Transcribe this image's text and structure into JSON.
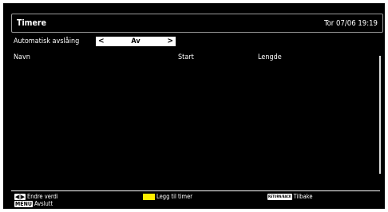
{
  "header": {
    "title": "Timere",
    "datetime": "Tor 07/06 19:19"
  },
  "auto_off": {
    "label": "Automatisk avslåing",
    "left_arrow": "<",
    "value": "Av",
    "right_arrow": ">"
  },
  "columns": {
    "name": "Navn",
    "start": "Start",
    "length": "Lengde"
  },
  "footer": {
    "arrows_key": "◀|▶",
    "change_value": "Endre verdi",
    "menu_key": "MENU",
    "exit": "Avslutt",
    "add_timer": "Legg til timer",
    "return_key": "RETURN/BACK",
    "back": "Tilbake"
  },
  "colors": {
    "background": "#000000",
    "accent_yellow": "#ffee00"
  }
}
